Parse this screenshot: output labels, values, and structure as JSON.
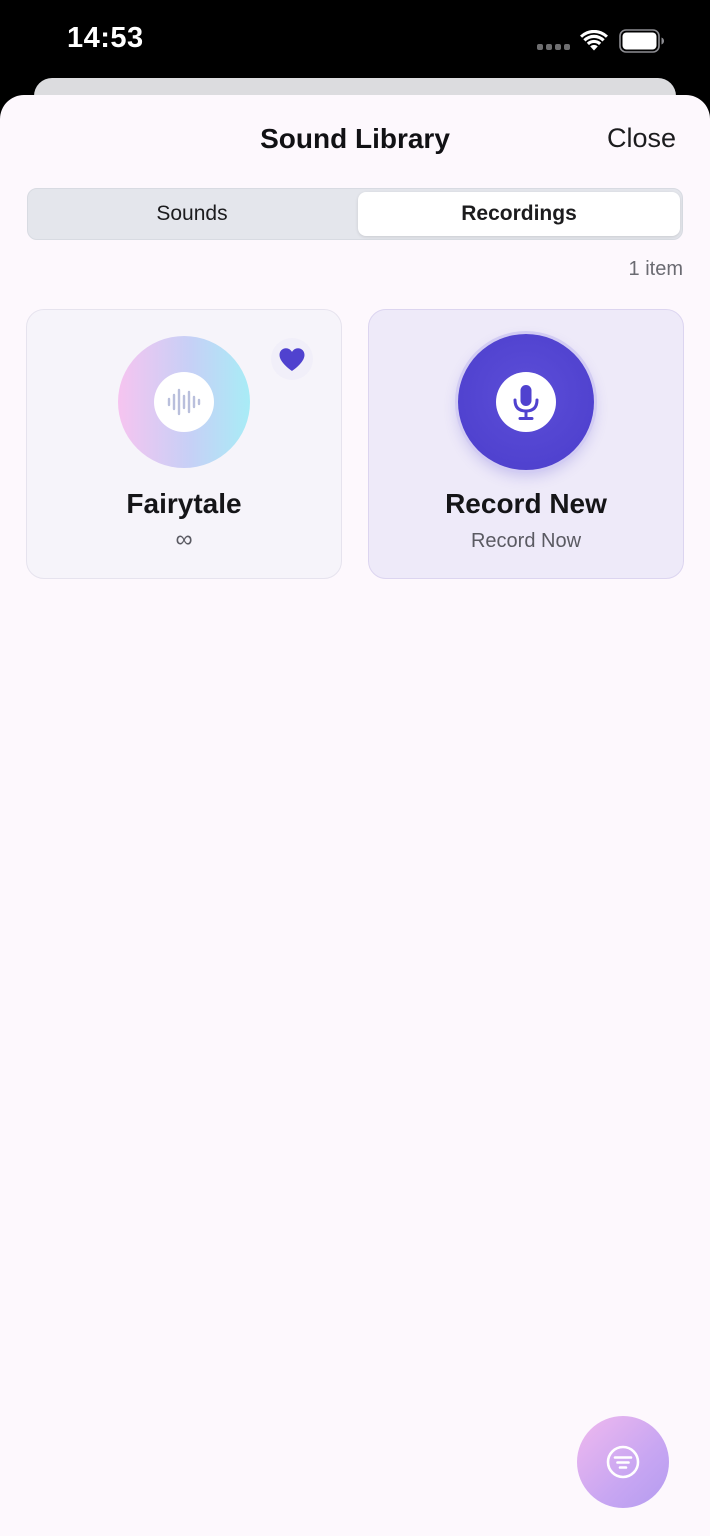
{
  "status_bar": {
    "time": "14:53"
  },
  "sheet": {
    "title": "Sound Library",
    "close_label": "Close"
  },
  "segmented_control": {
    "tabs": [
      {
        "label": "Sounds",
        "selected": false
      },
      {
        "label": "Recordings",
        "selected": true
      }
    ]
  },
  "item_count": "1 item",
  "cards": [
    {
      "title": "Fairytale",
      "subtitle": "∞",
      "favorite": true,
      "icon": "waveform-icon"
    },
    {
      "title": "Record New",
      "subtitle": "Record Now",
      "icon": "microphone-icon"
    }
  ],
  "fab": {
    "icon": "filter-icon"
  },
  "colors": {
    "accent": "#5042CF",
    "sheet_background": "#FDF8FD",
    "segment_track": "#E4E6EC",
    "fab_gradient_start": "#F0B9EE",
    "fab_gradient_end": "#B49CF0"
  }
}
